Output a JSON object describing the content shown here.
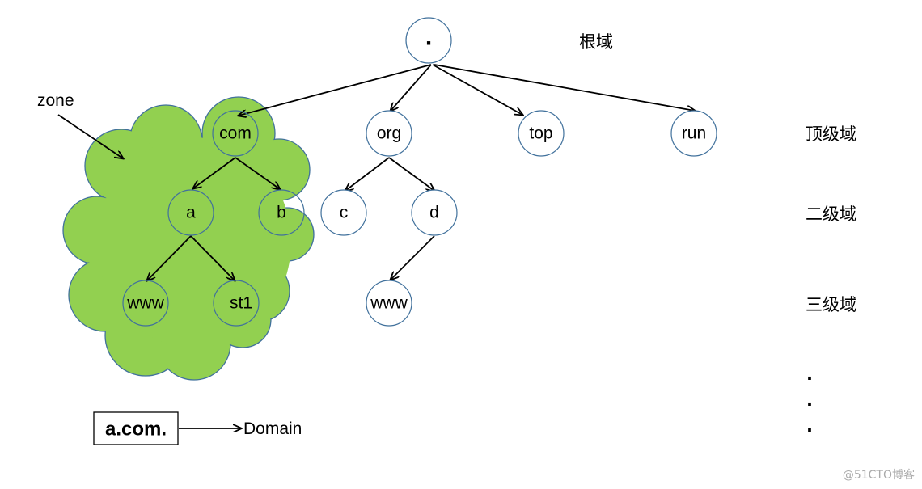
{
  "root_label": ".",
  "level_labels": {
    "root": "根域",
    "tld": "顶级域",
    "second": "二级域",
    "third": "三级域",
    "ellipsis": [
      ".",
      ".",
      "."
    ]
  },
  "nodes": {
    "com": "com",
    "org": "org",
    "top": "top",
    "run": "run",
    "a": "a",
    "b": "b",
    "c": "c",
    "d": "d",
    "a_www": "www",
    "st1": "st1",
    "d_www": "www"
  },
  "zone_label": "zone",
  "domain_example": {
    "box": "a.com.",
    "label": "Domain"
  },
  "watermark": "@51CTO博客",
  "colors": {
    "zone_fill": "#92d050",
    "outline": "#41719c"
  }
}
